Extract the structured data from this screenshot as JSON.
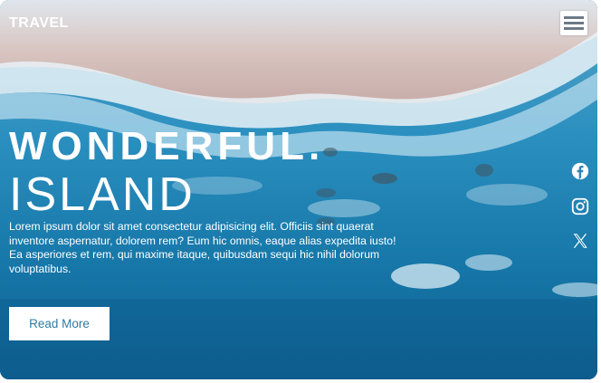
{
  "header": {
    "brand": "TRAVEL",
    "menu_icon": "menu-icon"
  },
  "hero": {
    "title_line1": "WONDERFUL.",
    "title_line2": "ISLAND",
    "description": "Lorem ipsum dolor sit amet consectetur adipisicing elit. Officiis sint quaerat inventore aspernatur, dolorem rem? Eum hic omnis, eaque alias expedita iusto! Ea asperiores et rem, qui maxime itaque, quibusdam sequi hic nihil dolorum voluptatibus.",
    "cta_label": "Read More"
  },
  "social": {
    "icons": [
      "facebook-icon",
      "instagram-icon",
      "x-icon"
    ]
  },
  "colors": {
    "ocean": "#1f86b6",
    "sand": "#cdb9b7",
    "text": "#ffffff",
    "button_text": "#2f7ba6"
  }
}
